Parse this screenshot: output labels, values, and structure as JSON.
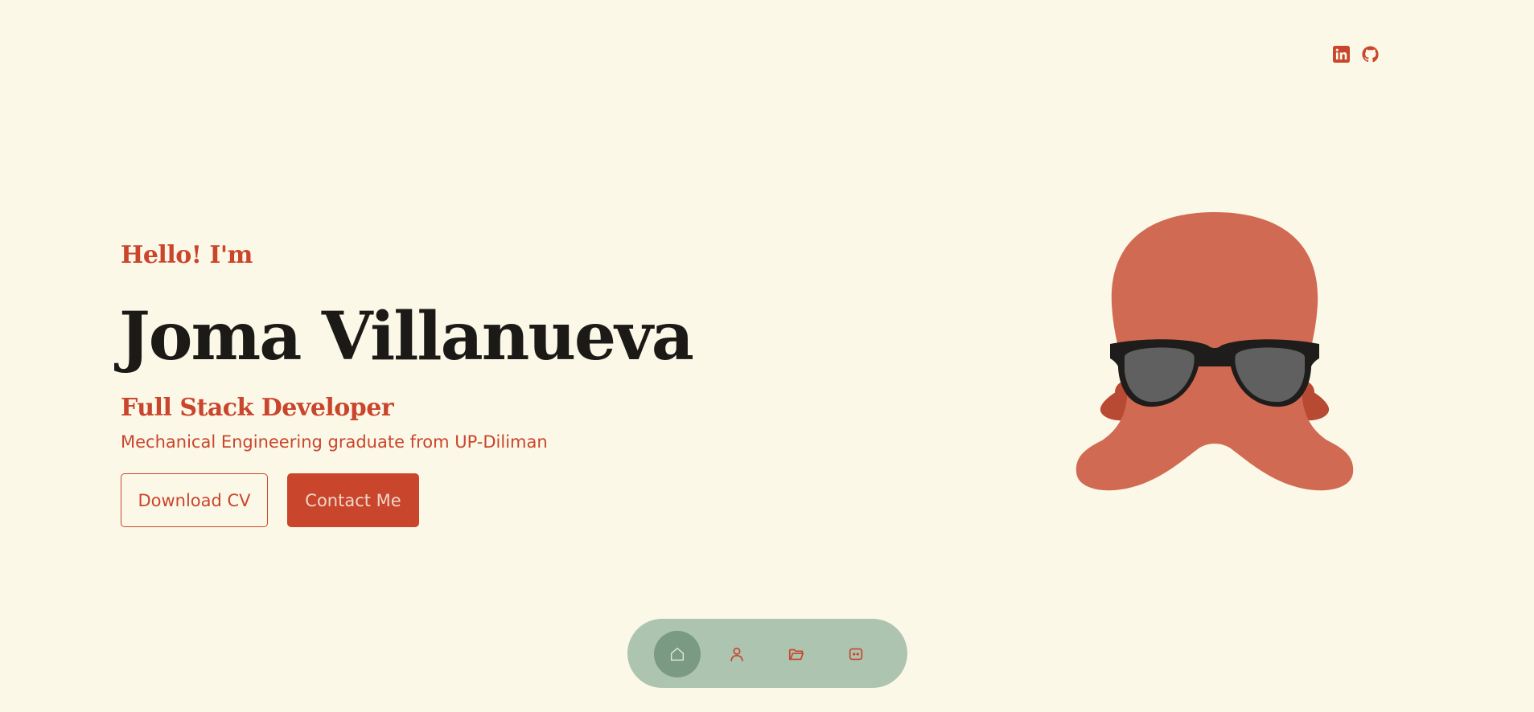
{
  "social": {
    "linkedin_icon": "linkedin-icon",
    "github_icon": "github-icon"
  },
  "hero": {
    "greeting": "Hello! I'm",
    "name": "Joma Villanueva",
    "role": "Full Stack Developer",
    "subtitle": "Mechanical Engineering graduate from UP-Diliman",
    "download_cv_label": "Download CV",
    "contact_label": "Contact Me"
  },
  "dock": {
    "items": [
      {
        "icon": "home-icon",
        "active": true
      },
      {
        "icon": "user-icon",
        "active": false
      },
      {
        "icon": "folder-icon",
        "active": false
      },
      {
        "icon": "chat-icon",
        "active": false
      }
    ]
  },
  "colors": {
    "background": "#fcf8e8",
    "accent": "#c9452b",
    "heading": "#1c1a17",
    "dock": "#acc4b0",
    "dock_active": "#7a9a84",
    "mascot": "#d16a52"
  }
}
